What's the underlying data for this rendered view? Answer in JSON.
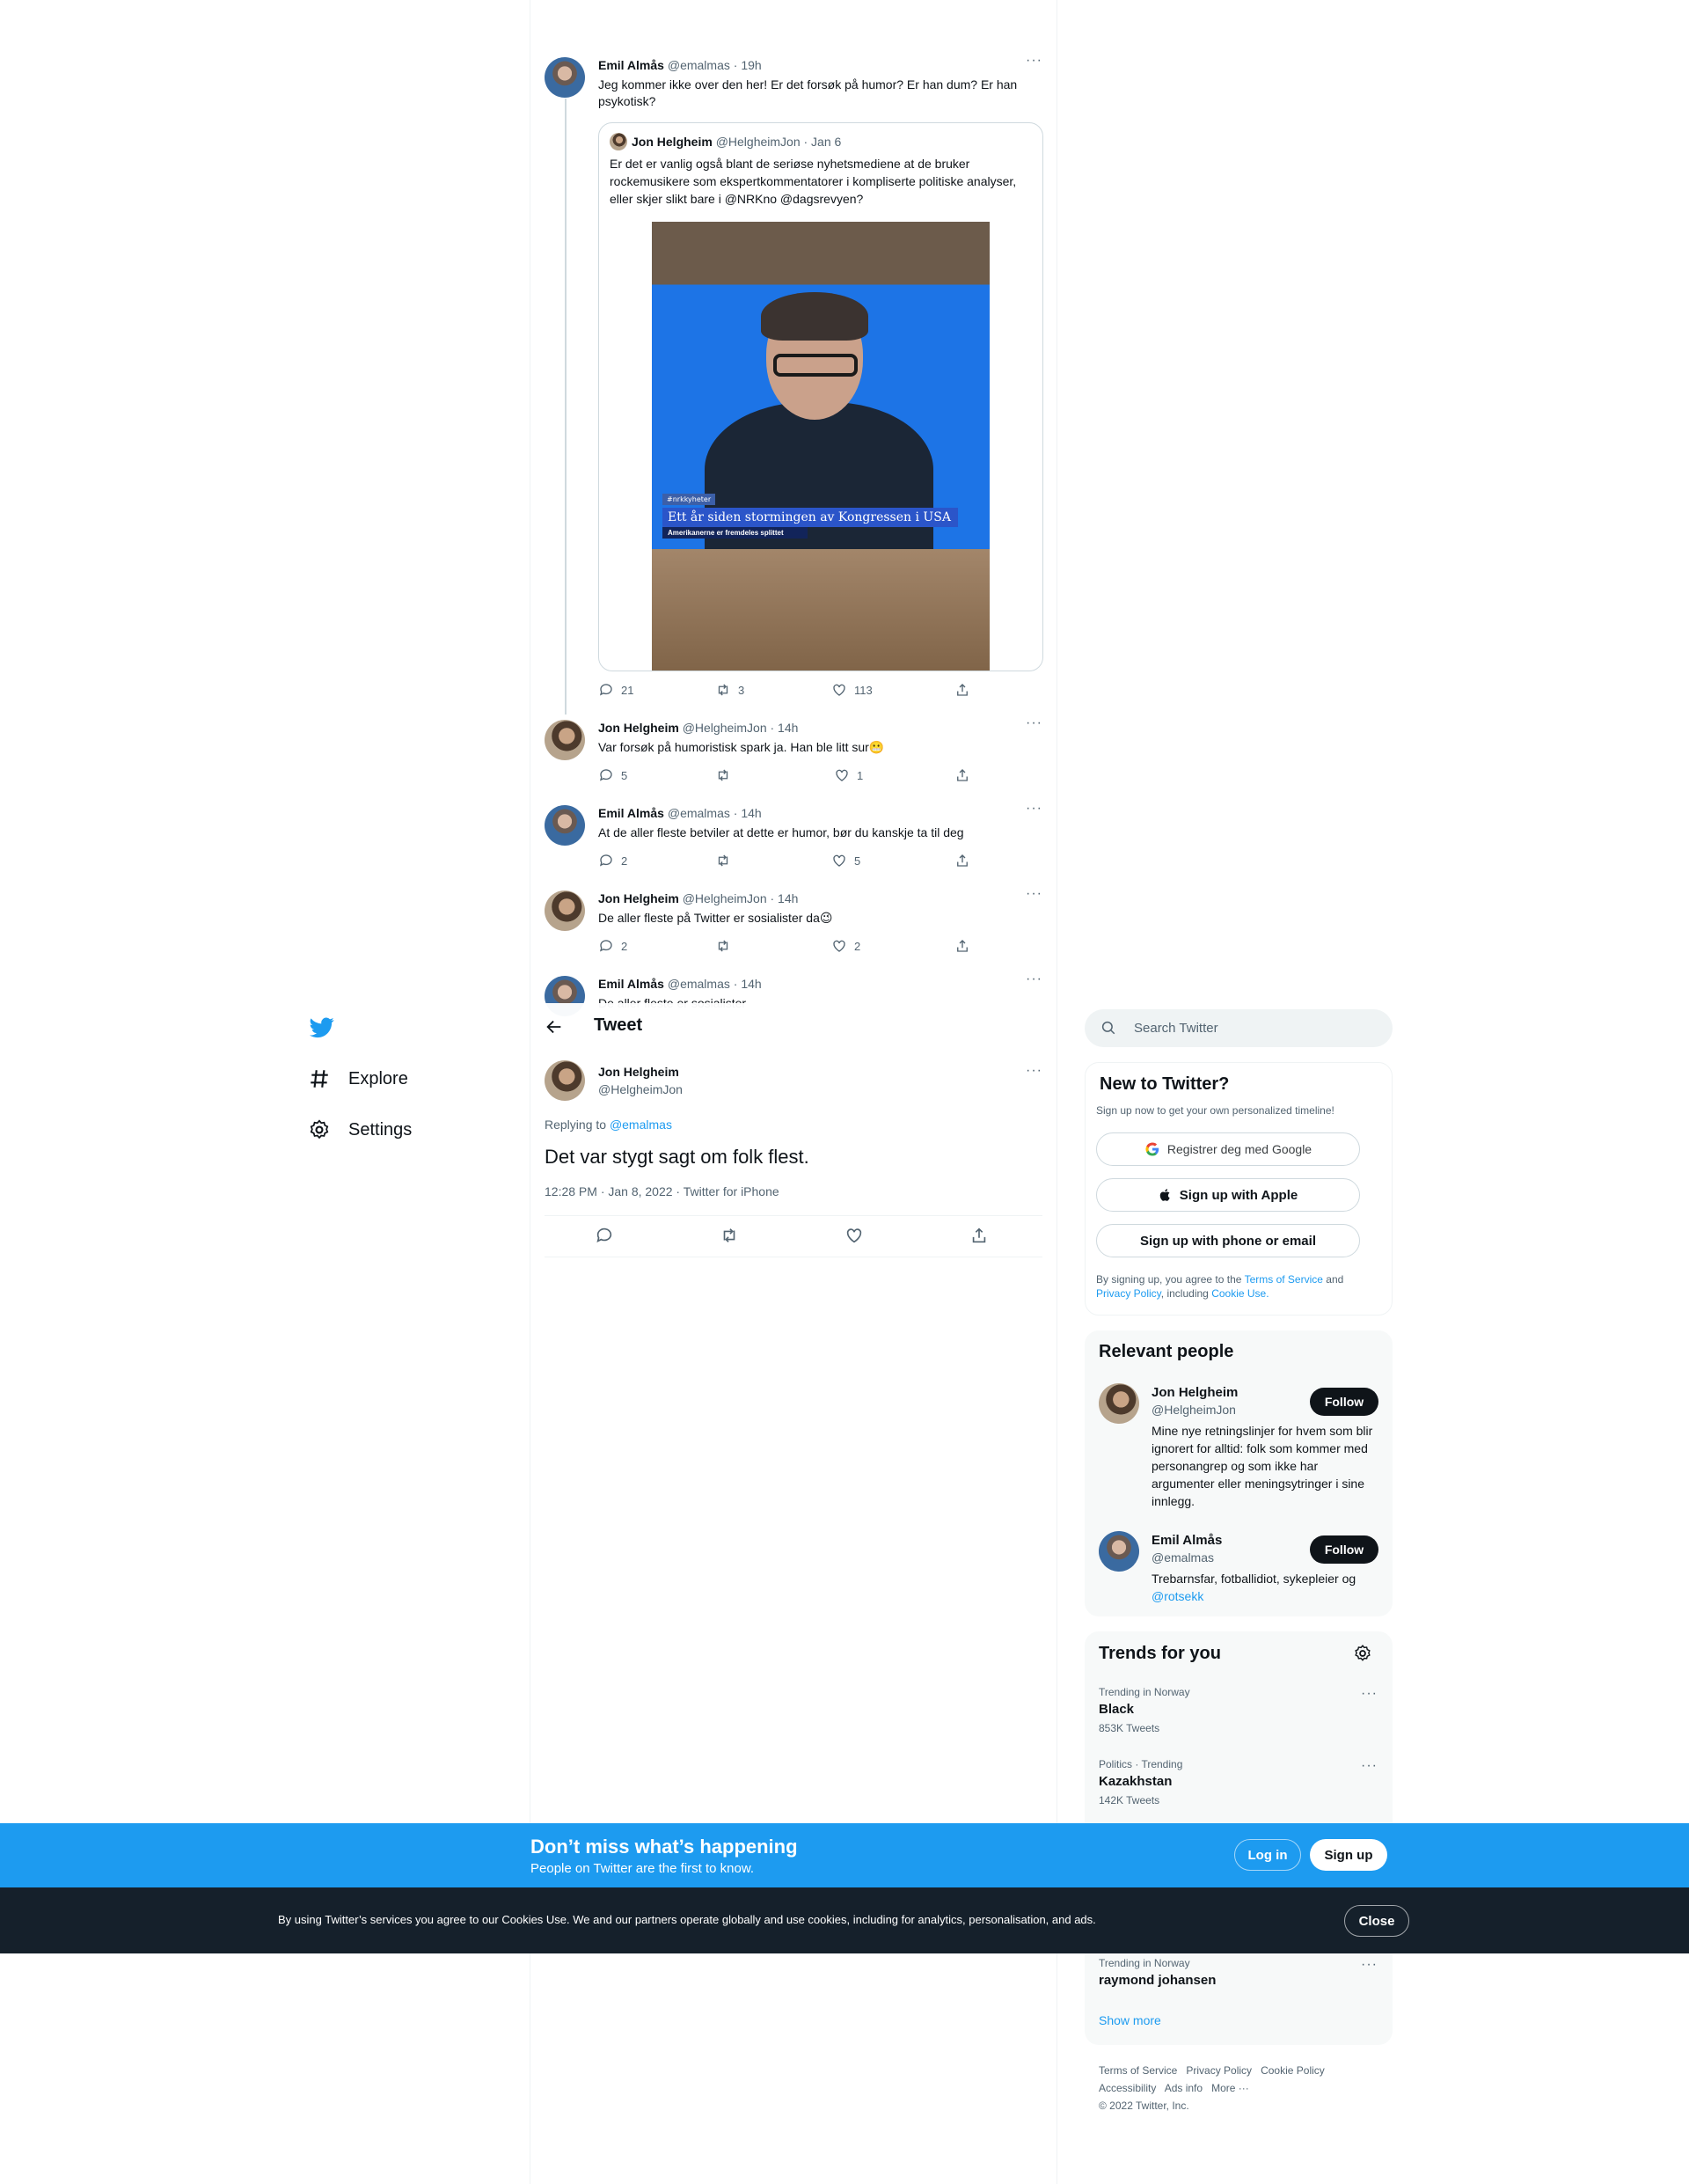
{
  "thread": {
    "original": {
      "name": "Emil Almås",
      "handle": "@emalmas",
      "time": "· 19h",
      "text": "Jeg kommer ikke over den her! Er det forsøk på humor? Er han dum? Er han psykotisk?",
      "quote": {
        "name": "Jon Helgheim",
        "handle": "@HelgheimJon",
        "time": "· Jan 6",
        "text": "Er det er vanlig også blant de seriøse nyhetsmediene at de bruker rockemusikere som ekspertkommentatorer i kompliserte politiske analyser, eller skjer slikt bare i @NRKno @dagsrevyen?",
        "image_overlay": {
          "tag": "#nrkkyheter",
          "title": "Ett år siden stormingen av Kongressen i USA",
          "subtitle": "Amerikanerne er fremdeles splittet"
        }
      },
      "replies": "21",
      "retweets": "3",
      "likes": "113"
    },
    "replies": [
      {
        "name": "Jon Helgheim",
        "handle": "@HelgheimJon",
        "time": "· 14h",
        "text": "Var forsøk på humoristisk spark ja. Han ble litt sur😬",
        "replies": "5",
        "retweets": "",
        "likes": "1"
      },
      {
        "name": "Emil Almås",
        "handle": "@emalmas",
        "time": "· 14h",
        "text": "At de aller fleste betviler at dette er humor, bør du kanskje ta til deg",
        "replies": "2",
        "retweets": "",
        "likes": "5"
      },
      {
        "name": "Jon Helgheim",
        "handle": "@HelgheimJon",
        "time": "· 14h",
        "text": "De aller fleste på Twitter er sosialister da😉",
        "replies": "2",
        "retweets": "",
        "likes": "2"
      },
      {
        "name": "Emil Almås",
        "handle": "@emalmas",
        "time": "· 14h",
        "text": "De aller fleste er sosialister"
      }
    ]
  },
  "header": {
    "title": "Tweet",
    "back_icon": "arrow-left-icon"
  },
  "nav": {
    "explore": "Explore",
    "settings": "Settings"
  },
  "main_tweet": {
    "name": "Jon Helgheim",
    "handle": "@HelgheimJon",
    "replying_prefix": "Replying to",
    "replying_to": "@emalmas",
    "text": "Det var stygt sagt om folk flest.",
    "meta": "12:28 PM · Jan 8, 2022 · Twitter for iPhone"
  },
  "search": {
    "placeholder": "Search Twitter"
  },
  "new_to_twitter": {
    "title": "New to Twitter?",
    "subtitle": "Sign up now to get your own personalized timeline!",
    "google": "Registrer deg med Google",
    "apple": "Sign up with Apple",
    "phone": "Sign up with phone or email",
    "legal_1": "By signing up, you agree to the",
    "terms": "Terms of Service",
    "legal_2": "and",
    "privacy": "Privacy Policy",
    "legal_3": ", including",
    "cookie": "Cookie Use."
  },
  "relevant_people": {
    "title": "Relevant people",
    "people": [
      {
        "name": "Jon Helgheim",
        "handle": "@HelgheimJon",
        "bio": "Mine nye retningslinjer for hvem som blir ignorert for alltid: folk som kommer med personangrep og som ikke har argumenter eller meningsytringer i sine innlegg.",
        "follow": "Follow"
      },
      {
        "name": "Emil Almås",
        "handle": "@emalmas",
        "bio": "Trebarnsfar, fotballidiot, sykepleier og",
        "bio_link": "@rotsekk",
        "follow": "Follow"
      }
    ]
  },
  "trends": {
    "title": "Trends for you",
    "items": [
      {
        "context": "Trending in Norway",
        "name": "Black",
        "count": "853K Tweets"
      },
      {
        "context": "Politics · Trending",
        "name": "Kazakhstan",
        "count": "142K Tweets"
      },
      {
        "context": "Trending in Norway",
        "name": "raymond johansen"
      }
    ],
    "show_more": "Show more"
  },
  "footer": {
    "terms": "Terms of Service",
    "privacy": "Privacy Policy",
    "cookie": "Cookie Policy",
    "accessibility": "Accessibility",
    "ads": "Ads info",
    "more": "More ···",
    "copyright": "© 2022 Twitter, Inc."
  },
  "banner": {
    "title": "Don’t miss what’s happening",
    "subtitle": "People on Twitter are the first to know.",
    "login": "Log in",
    "signup": "Sign up"
  },
  "cookie_bar": {
    "text": "By using Twitter’s services you agree to our Cookies Use. We and our partners operate globally and use cookies, including for analytics, personalisation, and ads.",
    "close": "Close"
  },
  "colors": {
    "brand": "#1d9bf0",
    "text": "#0f1419",
    "muted": "#536471",
    "dark_bar": "#15202b"
  }
}
